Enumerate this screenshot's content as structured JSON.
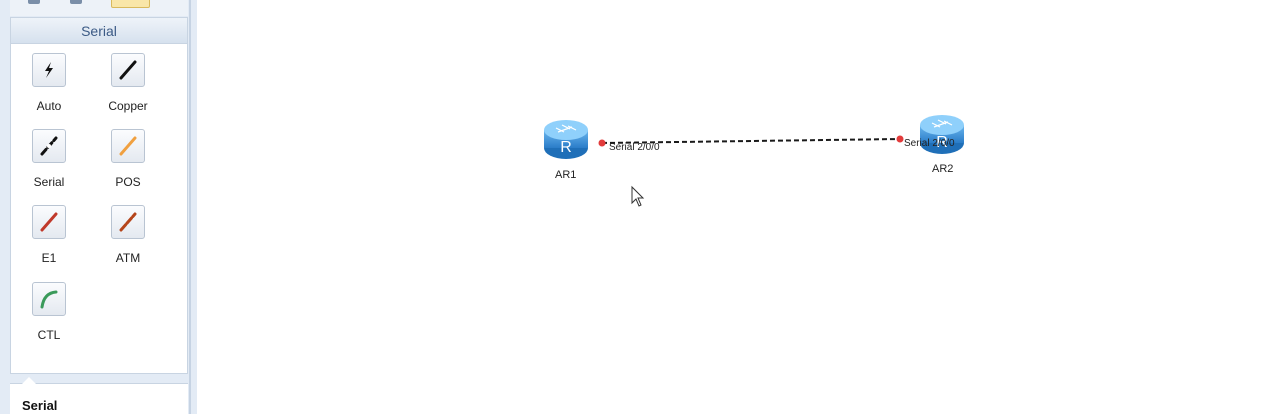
{
  "sidebar": {
    "section_title": "Serial",
    "tools": [
      {
        "label": "Auto",
        "icon": "auto-cable-icon"
      },
      {
        "label": "Copper",
        "icon": "copper-cable-icon"
      },
      {
        "label": "Serial",
        "icon": "serial-cable-icon"
      },
      {
        "label": "POS",
        "icon": "pos-cable-icon"
      },
      {
        "label": "E1",
        "icon": "e1-cable-icon"
      },
      {
        "label": "ATM",
        "icon": "atm-cable-icon"
      },
      {
        "label": "CTL",
        "icon": "ctl-cable-icon"
      }
    ],
    "bottom_title": "Serial"
  },
  "topology": {
    "devices": [
      {
        "name": "AR1",
        "icon": "router-icon"
      },
      {
        "name": "AR2",
        "icon": "router-icon"
      }
    ],
    "link": {
      "type": "serial",
      "from_port": "Serial 2/0/0",
      "to_port": "Serial 2/0/0"
    }
  },
  "colors": {
    "router_blue": "#3a8fd6",
    "port_dot": "#e23b3b",
    "copper": "#1a1a1a",
    "pos": "#f0a040",
    "e1": "#c0392b",
    "atm": "#b5451b",
    "ctl": "#3a9a5a"
  }
}
